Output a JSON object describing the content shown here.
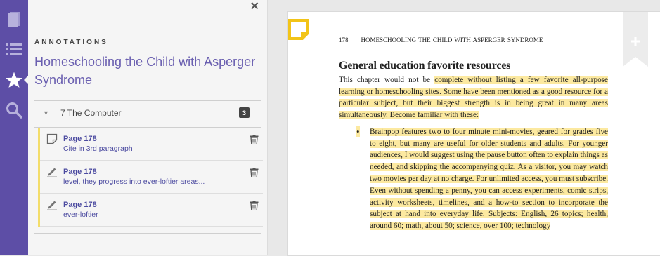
{
  "rail": {
    "items": [
      {
        "icon": "book-icon",
        "label": "Library"
      },
      {
        "icon": "list-icon",
        "label": "Contents"
      },
      {
        "icon": "star-icon",
        "label": "Annotations"
      },
      {
        "icon": "search-icon",
        "label": "Search"
      }
    ]
  },
  "panel": {
    "heading": "ANNOTATIONS",
    "book_title": "Homeschooling the Child with Asperger Syndrome",
    "close_glyph": "×"
  },
  "chapter": {
    "caret": "▼",
    "label": "7 The Computer",
    "count": "3"
  },
  "annotations": [
    {
      "type": "note",
      "icon": "note-icon",
      "page": "Page 178",
      "text": "Cite in 3rd paragraph"
    },
    {
      "type": "highlight",
      "icon": "highlighter-icon",
      "page": "Page 178",
      "text": "level, they progress into ever-loftier areas..."
    },
    {
      "type": "highlight",
      "icon": "highlighter-icon",
      "page": "Page 178",
      "text": "ever-loftier"
    }
  ],
  "page": {
    "number": "178",
    "running_head": "HOMESCHOOLING THE CHILD WITH ASPERGER SYNDROME",
    "section_title": "General education favorite resources",
    "intro_plain": "This chapter would not be ",
    "intro_highlight": "complete without listing a few favorite all-purpose learning or homeschooling sites. Some have been mentioned as a good resource for a particular subject, but their biggest strength is in being great in many areas simultaneously. Become familiar with these:",
    "bullet_glyph": "•",
    "bullet_text": "Brainpop features two to four minute mini-movies, geared for grades five to eight, but many are useful for older students and adults. For younger audiences, I would suggest using the pause button often to explain things as needed, and skipping the accompanying quiz. As a visitor, you may watch two movies per day at no charge. For unlimited access, you must subscribe. Even without spending a penny, you can access experiments, comic strips, activity worksheets, timelines, and a how-to section to incorporate the subject at hand into everyday life. Subjects: English, 26 topics; health, around 60; math, about 50; science, over 100; technology"
  },
  "colors": {
    "rail": "#5d4ea6",
    "accent": "#6a5fb0",
    "highlight": "#fce9a0",
    "note_marker": "#f2c418"
  }
}
